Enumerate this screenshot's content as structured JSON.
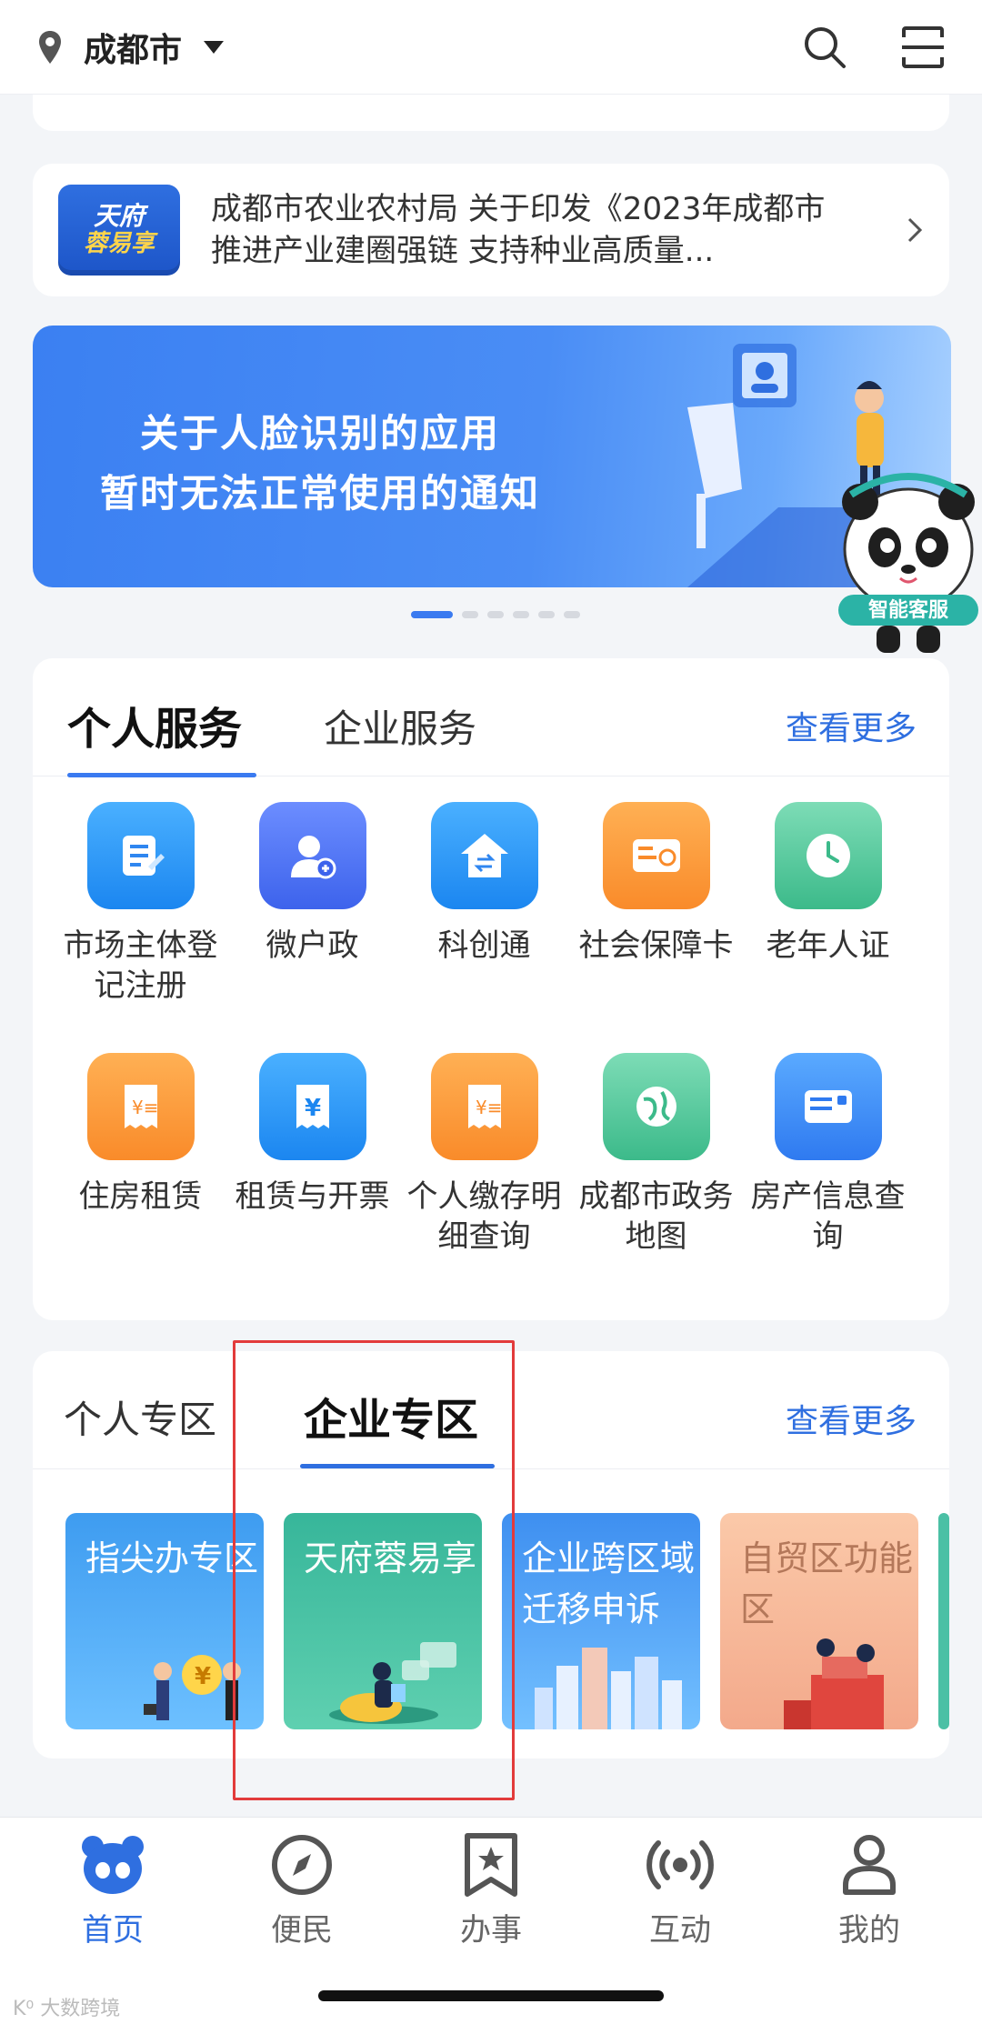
{
  "header": {
    "city": "成都市",
    "icons": {
      "location": "location-pin-icon",
      "search": "search-icon",
      "scan": "scan-icon"
    }
  },
  "news": {
    "logo_line1": "天府",
    "logo_line2": "蓉易享",
    "text": "成都市农业农村局 关于印发《2023年成都市推进产业建圈强链 支持种业高质量..."
  },
  "banner": {
    "line1": "关于人脸识别的应用",
    "line2": "暂时无法正常使用的通知"
  },
  "mascot": {
    "label": "智能客服"
  },
  "services": {
    "tab_active": "个人服务",
    "tab_other": "企业服务",
    "more": "查看更多",
    "items": [
      {
        "label": "市场主体登记注册",
        "color": "blue"
      },
      {
        "label": "微户政",
        "color": "indigo"
      },
      {
        "label": "科创通",
        "color": "blue"
      },
      {
        "label": "社会保障卡",
        "color": "orange"
      },
      {
        "label": "老年人证",
        "color": "green"
      },
      {
        "label": "住房租赁",
        "color": "orange"
      },
      {
        "label": "租赁与开票",
        "color": "blue"
      },
      {
        "label": "个人缴存明细查询",
        "color": "orange"
      },
      {
        "label": "成都市政务地图",
        "color": "green"
      },
      {
        "label": "房产信息查询",
        "color": "blue2"
      }
    ]
  },
  "zone": {
    "tab_other": "个人专区",
    "tab_active": "企业专区",
    "more": "查看更多",
    "cards": [
      {
        "label": "指尖办专区"
      },
      {
        "label": "天府蓉易享"
      },
      {
        "label": "企业跨区域迁移申诉"
      },
      {
        "label": "自贸区功能区"
      }
    ]
  },
  "nav": {
    "items": [
      {
        "label": "首页",
        "icon": "panda-home-icon",
        "active": true
      },
      {
        "label": "便民",
        "icon": "compass-icon",
        "active": false
      },
      {
        "label": "办事",
        "icon": "bookmark-star-icon",
        "active": false
      },
      {
        "label": "互动",
        "icon": "broadcast-icon",
        "active": false
      },
      {
        "label": "我的",
        "icon": "user-icon",
        "active": false
      }
    ]
  },
  "watermark": "K⁰ 大数跨境"
}
